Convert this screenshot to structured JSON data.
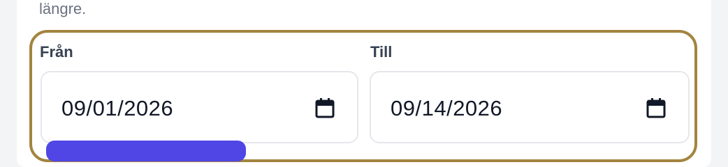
{
  "helper": {
    "text": "längre."
  },
  "date_range": {
    "from": {
      "label": "Från",
      "value": "09/01/2026",
      "icon": "calendar-icon"
    },
    "to": {
      "label": "Till",
      "value": "09/14/2026",
      "icon": "calendar-icon"
    },
    "highlight_color": "#a3843f"
  },
  "submit": {
    "color": "#4f46e5"
  }
}
